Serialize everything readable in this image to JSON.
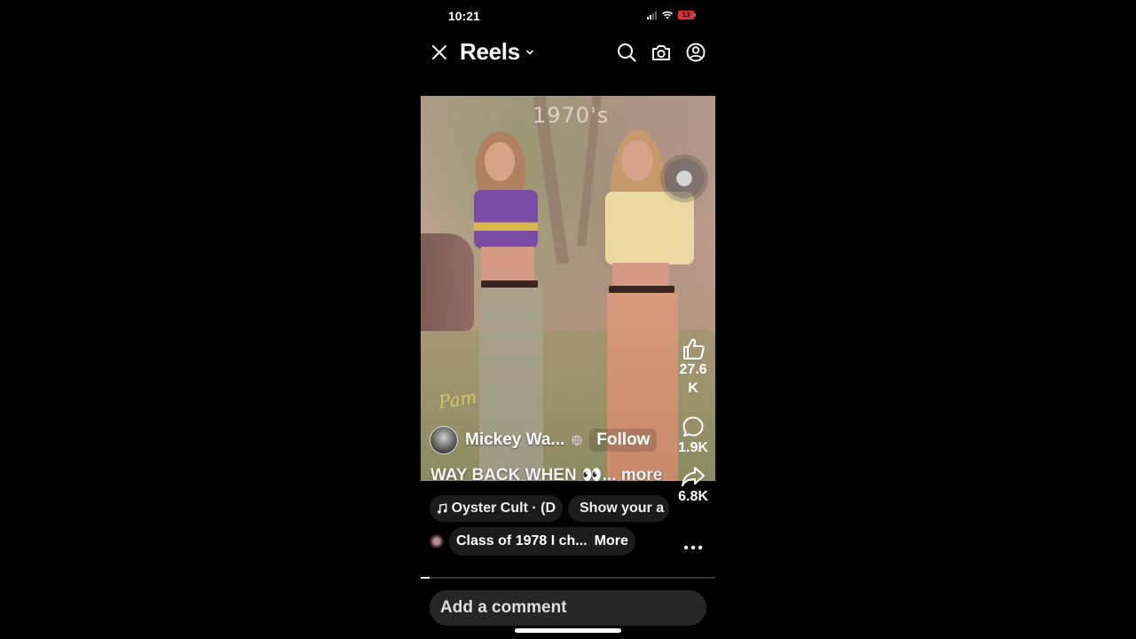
{
  "status_bar": {
    "time": "10:21",
    "battery": "13"
  },
  "header": {
    "title": "Reels"
  },
  "video": {
    "overlay_year": "1970's",
    "overlay_name": "Pam"
  },
  "post": {
    "author": "Mickey Wa...",
    "follow_label": "Follow",
    "caption": "WAY BACK WHEN 👀... more"
  },
  "actions": {
    "likes": "27.6K",
    "comments": "1.9K",
    "shares": "6.8K"
  },
  "chips": {
    "music": "Oyster Cult · (D",
    "show": "Show your a"
  },
  "group": {
    "label": "Class of 1978 I ch...",
    "more_label": "More"
  },
  "progress": 0.03,
  "comment": {
    "placeholder": "Add a comment"
  }
}
